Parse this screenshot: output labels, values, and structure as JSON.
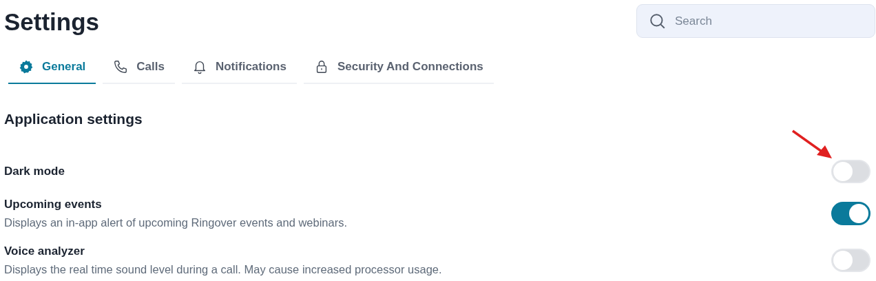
{
  "title": "Settings",
  "search": {
    "placeholder": "Search"
  },
  "tabs": [
    {
      "label": "General",
      "kind": "gear",
      "selected": true
    },
    {
      "label": "Calls",
      "kind": "phone",
      "selected": false
    },
    {
      "label": "Notifications",
      "kind": "bell",
      "selected": false
    },
    {
      "label": "Security And Connections",
      "kind": "lock",
      "selected": false
    }
  ],
  "section": {
    "heading": "Application settings",
    "settings": [
      {
        "name": "Dark mode",
        "on": false
      },
      {
        "name": "Upcoming events",
        "description": "Displays an in-app alert of upcoming Ringover events and webinars.",
        "on": true
      },
      {
        "name": "Voice analyzer",
        "description": "Displays the real time sound level during a call. May cause increased processor usage.",
        "on": false
      }
    ]
  }
}
